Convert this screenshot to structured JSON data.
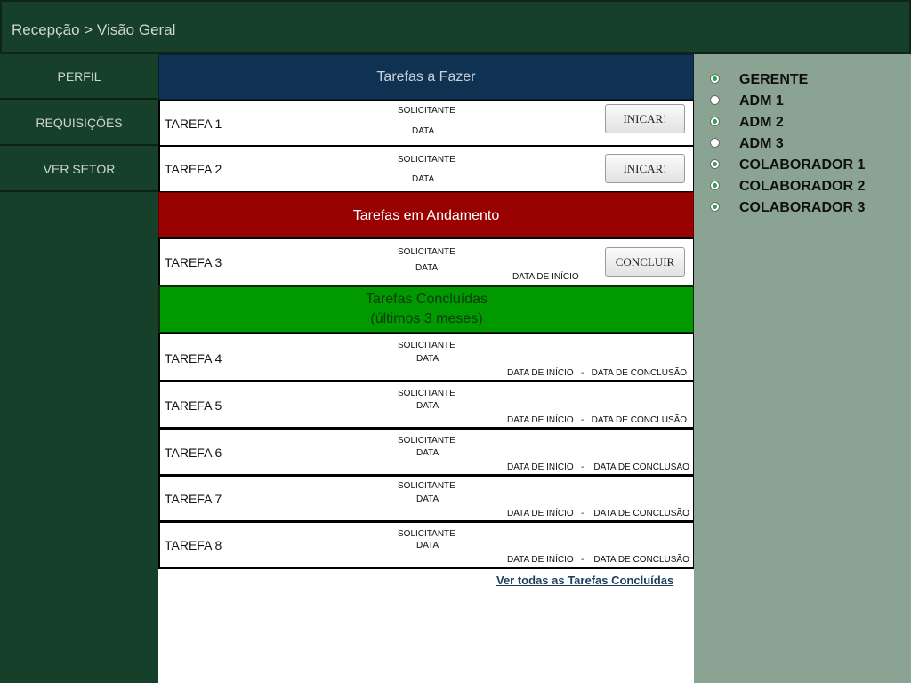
{
  "header": {
    "breadcrumb": "Recepção > Visão Geral"
  },
  "sidebar": {
    "items": [
      {
        "label": "PERFIL"
      },
      {
        "label": "REQUISIÇÕES"
      },
      {
        "label": "VER SETOR"
      }
    ]
  },
  "sections": {
    "todo": {
      "title": "Tarefas a Fazer"
    },
    "in_progress": {
      "title": "Tarefas em Andamento"
    },
    "done": {
      "title": "Tarefas Concluídas",
      "subtitle": "(últimos 3 meses)"
    }
  },
  "todo_tasks": [
    {
      "name": "TAREFA 1",
      "requester": "SOLICITANTE",
      "date": "DATA",
      "button": "INICAR!"
    },
    {
      "name": "TAREFA 2",
      "requester": "SOLICITANTE",
      "date": "DATA",
      "button": "INICAR!"
    }
  ],
  "in_progress_tasks": [
    {
      "name": "TAREFA 3",
      "requester": "SOLICITANTE",
      "date": "DATA",
      "start": "DATA DE INÍCIO",
      "button": "CONCLUIR"
    }
  ],
  "done_tasks": [
    {
      "name": "TAREFA 4",
      "requester": "SOLICITANTE",
      "date": "DATA",
      "dates": "DATA DE INÍCIO   -   DATA DE CONCLUSÃO"
    },
    {
      "name": "TAREFA 5",
      "requester": "SOLICITANTE",
      "date": "DATA",
      "dates": "DATA DE INÍCIO   -   DATA DE CONCLUSÃO"
    },
    {
      "name": "TAREFA 6",
      "requester": "SOLICITANTE",
      "date": "DATA",
      "dates": "DATA DE INÍCIO   -    DATA DE CONCLUSÃO"
    },
    {
      "name": "TAREFA 7",
      "requester": "SOLICITANTE",
      "date": "DATA",
      "dates": "DATA DE INÍCIO   -    DATA DE CONCLUSÃO"
    },
    {
      "name": "TAREFA 8",
      "requester": "SOLICITANTE",
      "date": "DATA",
      "dates": "DATA DE INÍCIO   -    DATA DE CONCLUSÃO"
    }
  ],
  "see_all_link": "Ver todas as Tarefas Concluídas",
  "users": [
    {
      "label": "GERENTE",
      "checked": true
    },
    {
      "label": "ADM 1",
      "checked": false
    },
    {
      "label": "ADM 2",
      "checked": true
    },
    {
      "label": "ADM 3",
      "checked": false
    },
    {
      "label": "COLABORADOR 1",
      "checked": true
    },
    {
      "label": "COLABORADOR 2",
      "checked": true
    },
    {
      "label": "COLABORADOR 3",
      "checked": true
    }
  ]
}
